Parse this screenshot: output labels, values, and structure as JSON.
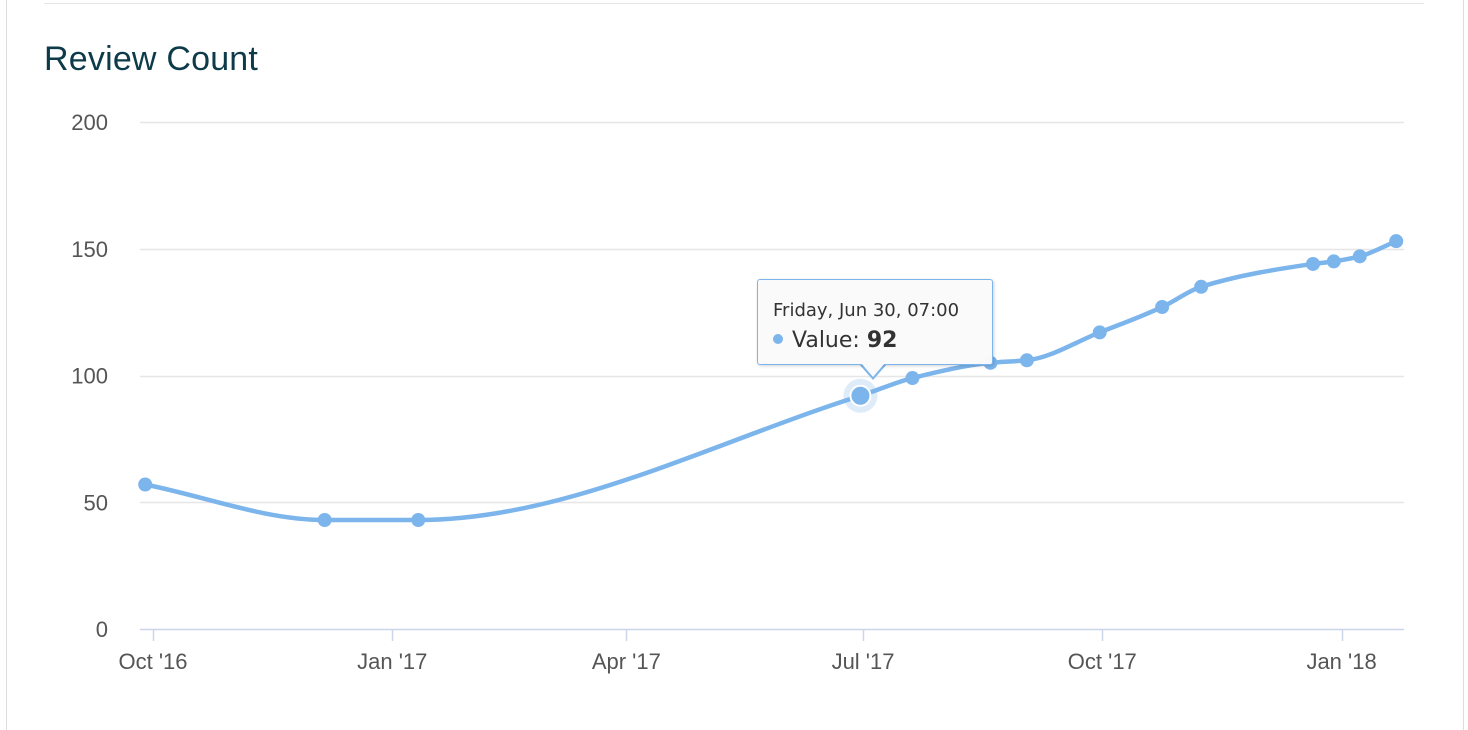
{
  "chart_data": {
    "type": "line",
    "title": "Review Count",
    "xlabel": "",
    "ylabel": "",
    "ylim": [
      0,
      200
    ],
    "y_ticks": [
      0,
      50,
      100,
      150,
      200
    ],
    "x_range": [
      "2016-09-26",
      "2018-01-25"
    ],
    "x_ticks": [
      {
        "date": "2016-10-01",
        "label": "Oct '16"
      },
      {
        "date": "2017-01-01",
        "label": "Jan '17"
      },
      {
        "date": "2017-04-01",
        "label": "Apr '17"
      },
      {
        "date": "2017-07-01",
        "label": "Jul '17"
      },
      {
        "date": "2017-10-01",
        "label": "Oct '17"
      },
      {
        "date": "2018-01-01",
        "label": "Jan '18"
      }
    ],
    "grid": true,
    "legend": "none",
    "series_color": "#7cb5ec",
    "series": [
      {
        "points": [
          {
            "x": "2016-09-28",
            "y": 57
          },
          {
            "x": "2016-12-06",
            "y": 43
          },
          {
            "x": "2017-01-11",
            "y": 43
          },
          {
            "x": "2017-06-30",
            "y": 92
          },
          {
            "x": "2017-07-20",
            "y": 99
          },
          {
            "x": "2017-08-19",
            "y": 105
          },
          {
            "x": "2017-09-02",
            "y": 106
          },
          {
            "x": "2017-09-30",
            "y": 117
          },
          {
            "x": "2017-10-24",
            "y": 127
          },
          {
            "x": "2017-11-08",
            "y": 135
          },
          {
            "x": "2017-12-21",
            "y": 144
          },
          {
            "x": "2017-12-29",
            "y": 145
          },
          {
            "x": "2018-01-08",
            "y": 147
          },
          {
            "x": "2018-01-22",
            "y": 153
          }
        ]
      }
    ],
    "tooltip": {
      "header": "Friday, Jun 30, 07:00",
      "label": "Value",
      "value": "92",
      "point_x": "2017-06-30"
    }
  }
}
